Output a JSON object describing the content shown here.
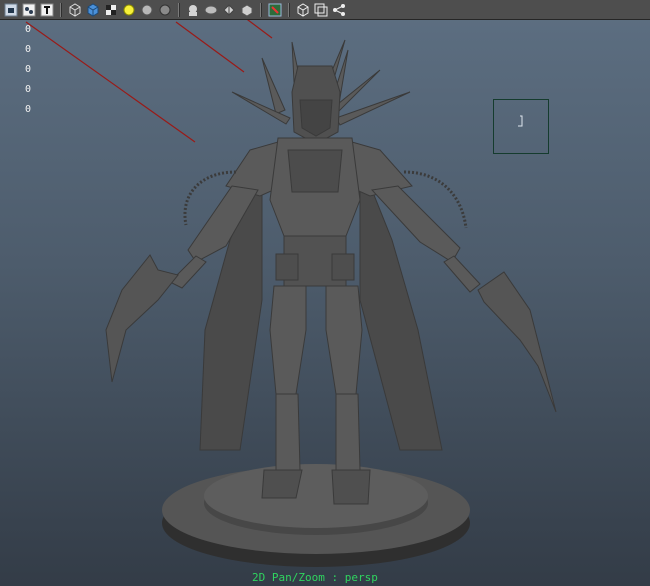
{
  "toolbar": {
    "icons": [
      "select-camera-icon",
      "camera-attributes-icon",
      "text-icon",
      "wireframe-icon",
      "smooth-shade-icon",
      "textured-icon",
      "default-light-icon",
      "shadows-icon",
      "ambient-occlusion-icon",
      "xray-icon",
      "isolate-select-icon",
      "backface-icon",
      "grid-icon",
      "resolution-gate-icon",
      "bounding-box-icon",
      "field-chart-icon",
      "safe-action-icon"
    ]
  },
  "readouts": [
    "0",
    "0",
    "0",
    "0",
    "0"
  ],
  "status": {
    "text": "2D Pan/Zoom : persp"
  },
  "colors": {
    "viewport_top": "#5d6f82",
    "viewport_bottom": "#333c47",
    "model": "#5a5a5a",
    "status_text": "#2fd45f",
    "red_lines": "#9a1a17"
  }
}
